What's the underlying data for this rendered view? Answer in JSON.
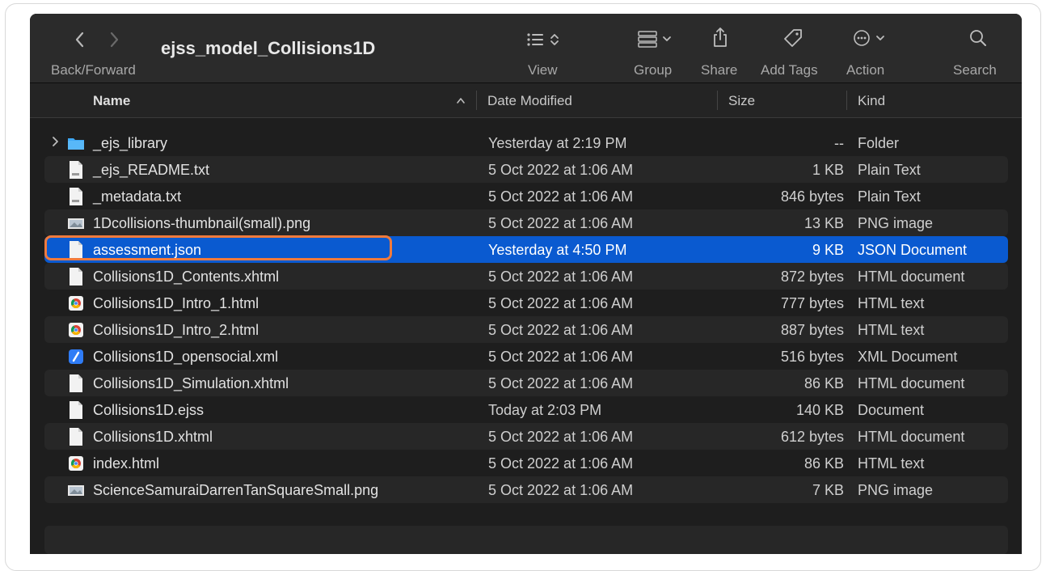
{
  "toolbar": {
    "title": "ejss_model_Collisions1D",
    "back_forward_label": "Back/Forward",
    "view_label": "View",
    "group_label": "Group",
    "share_label": "Share",
    "add_tags_label": "Add Tags",
    "action_label": "Action",
    "search_label": "Search"
  },
  "columns": {
    "name": "Name",
    "date_modified": "Date Modified",
    "size": "Size",
    "kind": "Kind"
  },
  "files": [
    {
      "name": "_ejs_library",
      "date": "Yesterday at 2:19 PM",
      "size": "--",
      "kind": "Folder",
      "icon": "folder-icon"
    },
    {
      "name": "_ejs_README.txt",
      "date": "5 Oct 2022 at 1:06 AM",
      "size": "1 KB",
      "kind": "Plain Text",
      "icon": "text-file-icon"
    },
    {
      "name": "_metadata.txt",
      "date": "5 Oct 2022 at 1:06 AM",
      "size": "846 bytes",
      "kind": "Plain Text",
      "icon": "text-file-icon"
    },
    {
      "name": "1Dcollisions-thumbnail(small).png",
      "date": "5 Oct 2022 at 1:06 AM",
      "size": "13 KB",
      "kind": "PNG image",
      "icon": "image-thumbnail-icon"
    },
    {
      "name": "assessment.json",
      "date": "Yesterday at 4:50 PM",
      "size": "9 KB",
      "kind": "JSON Document",
      "icon": "document-icon"
    },
    {
      "name": "Collisions1D_Contents.xhtml",
      "date": "5 Oct 2022 at 1:06 AM",
      "size": "872 bytes",
      "kind": "HTML document",
      "icon": "document-icon"
    },
    {
      "name": "Collisions1D_Intro_1.html",
      "date": "5 Oct 2022 at 1:06 AM",
      "size": "777 bytes",
      "kind": "HTML text",
      "icon": "chrome-html-icon"
    },
    {
      "name": "Collisions1D_Intro_2.html",
      "date": "5 Oct 2022 at 1:06 AM",
      "size": "887 bytes",
      "kind": "HTML text",
      "icon": "chrome-html-icon"
    },
    {
      "name": "Collisions1D_opensocial.xml",
      "date": "5 Oct 2022 at 1:06 AM",
      "size": "516 bytes",
      "kind": "XML Document",
      "icon": "xml-file-icon"
    },
    {
      "name": "Collisions1D_Simulation.xhtml",
      "date": "5 Oct 2022 at 1:06 AM",
      "size": "86 KB",
      "kind": "HTML document",
      "icon": "document-icon"
    },
    {
      "name": "Collisions1D.ejss",
      "date": "Today at 2:03 PM",
      "size": "140 KB",
      "kind": "Document",
      "icon": "document-icon"
    },
    {
      "name": "Collisions1D.xhtml",
      "date": "5 Oct 2022 at 1:06 AM",
      "size": "612 bytes",
      "kind": "HTML document",
      "icon": "document-icon"
    },
    {
      "name": "index.html",
      "date": "5 Oct 2022 at 1:06 AM",
      "size": "86 KB",
      "kind": "HTML text",
      "icon": "chrome-html-icon"
    },
    {
      "name": "ScienceSamuraiDarrenTanSquareSmall.png",
      "date": "5 Oct 2022 at 1:06 AM",
      "size": "7 KB",
      "kind": "PNG image",
      "icon": "image-thumbnail-icon"
    }
  ],
  "selected_index": 4,
  "colors": {
    "selection": "#0a5ad0",
    "highlight_outline": "#f07a3c",
    "folder": "#3ea8f5"
  }
}
